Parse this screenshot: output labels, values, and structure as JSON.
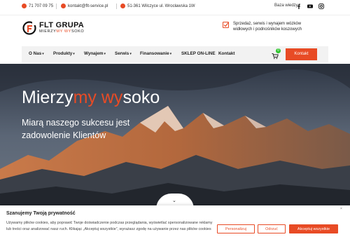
{
  "topbar": {
    "phone": "71 707 09 75",
    "email": "kontakt@flt-service.pl",
    "address": "51-361 Wilczyce ul. Wrocławska 1W",
    "knowledge": "Baza wiedzy",
    "social": [
      "facebook-icon",
      "youtube-icon",
      "instagram-icon"
    ]
  },
  "header": {
    "logo_title": "FLT GRUPA",
    "logo_sub_a": "MIERZY",
    "logo_sub_b": "MY WY",
    "logo_sub_c": "SOKO",
    "promo_line1": "Sprzedaż, serwis i wynajem wózków",
    "promo_line2": "widłowych i podnośników koszowych"
  },
  "nav": {
    "items": [
      {
        "label": "O Nas",
        "dropdown": true
      },
      {
        "label": "Produkty",
        "dropdown": true
      },
      {
        "label": "Wynajem",
        "dropdown": true
      },
      {
        "label": "Serwis",
        "dropdown": true
      },
      {
        "label": "Finansowanie",
        "dropdown": true
      },
      {
        "label": "SKLEP ON-LINE",
        "dropdown": false
      },
      {
        "label": "Kontakt",
        "dropdown": false
      }
    ],
    "cart_count": "0",
    "contact_button": "Kontakt"
  },
  "hero": {
    "title_a": "Mierzy",
    "title_b": "my wy",
    "title_c": "soko",
    "subtitle": "Miarą naszego sukcesu jest zadowolenie Klientów",
    "scroll_icon": "chevron-down-icon"
  },
  "cookie": {
    "close": "×",
    "title": "Szanujemy Twoją prywatność",
    "text": "Używamy plików cookies, aby poprawić Twoje doświadczenie podczas przeglądania, wyświetlać spersonalizowane reklamy lub treści oraz analizować nasz ruch. Klikając „Akceptuj wszystkie”, wyrażasz zgodę na używanie przez nas plików cookies",
    "btn_personalize": "Personalizuj",
    "btn_reject": "Odrzuć",
    "btn_accept": "Akceptuj wszystkie"
  },
  "colors": {
    "accent": "#e84b25",
    "badge": "#2ec42e",
    "nav_bg": "#f2f2f2"
  }
}
